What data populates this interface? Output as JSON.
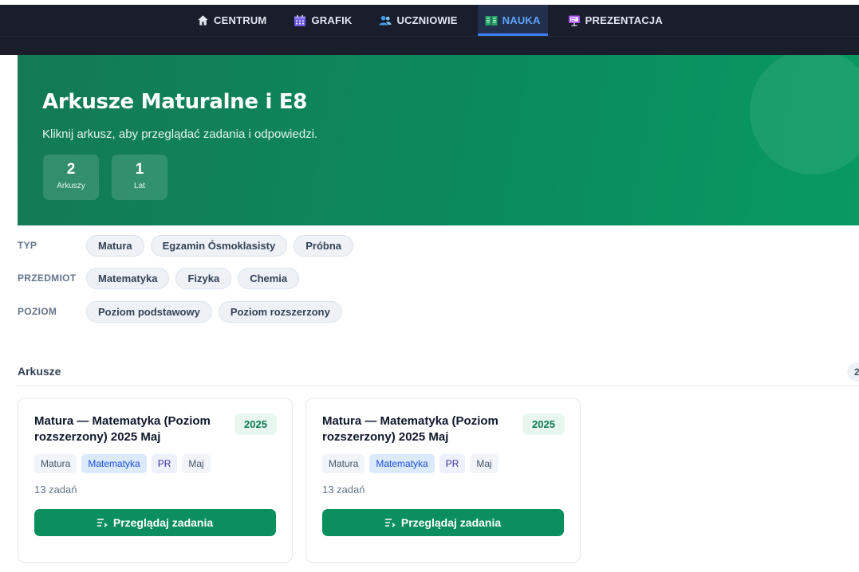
{
  "nav": {
    "items": [
      {
        "label": "CENTRUM",
        "icon": "home-icon",
        "active": false
      },
      {
        "label": "GRAFIK",
        "icon": "calendar-icon",
        "active": false
      },
      {
        "label": "UCZNIOWIE",
        "icon": "users-icon",
        "active": false
      },
      {
        "label": "NAUKA",
        "icon": "book-icon",
        "active": true
      },
      {
        "label": "PREZENTACJA",
        "icon": "presentation-icon",
        "active": false
      }
    ]
  },
  "hero": {
    "title": "Arkusze Maturalne i E8",
    "subtitle": "Kliknij arkusz, aby przeglądać zadania i odpowiedzi.",
    "stats": [
      {
        "value": "2",
        "label": "Arkuszy"
      },
      {
        "value": "1",
        "label": "Lat"
      }
    ]
  },
  "filters": {
    "typ": {
      "label": "TYP",
      "options": [
        "Matura",
        "Egzamin Ósmoklasisty",
        "Próbna"
      ]
    },
    "przedmiot": {
      "label": "PRZEDMIOT",
      "options": [
        "Matematyka",
        "Fizyka",
        "Chemia"
      ]
    },
    "poziom": {
      "label": "POZIOM",
      "options": [
        "Poziom podstawowy",
        "Poziom rozszerzony"
      ]
    }
  },
  "section": {
    "title": "Arkusze",
    "badge": "2"
  },
  "cards": [
    {
      "title": "Matura — Matematyka (Poziom rozszerzony) 2025 Maj",
      "year": "2025",
      "tags": [
        "Matura",
        "Matematyka",
        "PR",
        "Maj"
      ],
      "count": "13 zadań",
      "button": "Przeglądaj zadania"
    },
    {
      "title": "Matura — Matematyka (Poziom rozszerzony) 2025 Maj",
      "year": "2025",
      "tags": [
        "Matura",
        "Matematyka",
        "PR",
        "Maj"
      ],
      "count": "13 zadań",
      "button": "Przeglądaj zadania"
    }
  ],
  "colors": {
    "nav_bg": "#1a1d2b",
    "nav_active": "#60a5fa",
    "hero_green": "#0b8a5c",
    "button_green": "#0b8f5f"
  }
}
